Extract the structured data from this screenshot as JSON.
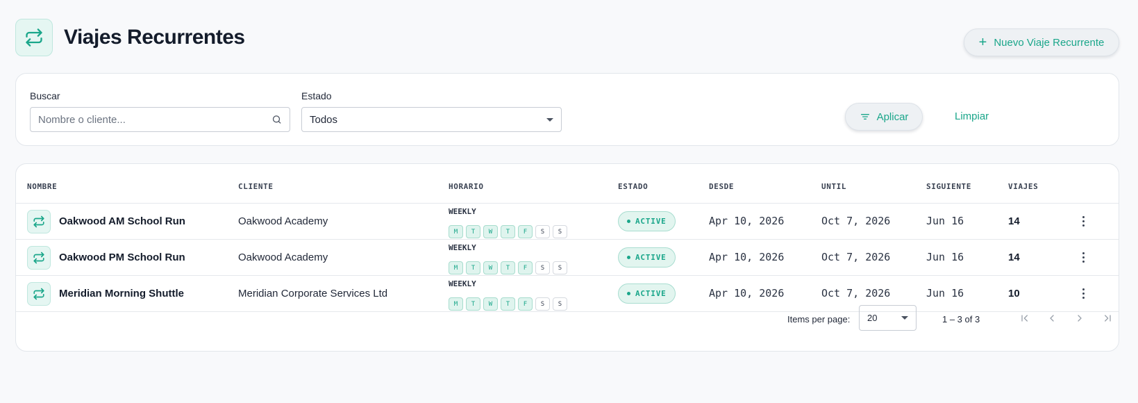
{
  "header": {
    "title": "Viajes Recurrentes",
    "icon": "repeat-icon",
    "new_button_label": "Nuevo Viaje Recurrente"
  },
  "filters": {
    "search_label": "Buscar",
    "search_placeholder": "Nombre o cliente...",
    "status_label": "Estado",
    "status_value": "Todos",
    "apply_label": "Aplicar",
    "clear_label": "Limpiar"
  },
  "table": {
    "columns": [
      "NOMBRE",
      "CLIENTE",
      "HORARIO",
      "ESTADO",
      "DESDE",
      "UNTIL",
      "SIGUIENTE",
      "VIAJES"
    ],
    "rows": [
      {
        "name": "Oakwood AM School Run",
        "client": "Oakwood Academy",
        "schedule": "WEEKLY",
        "days": [
          {
            "label": "M",
            "active": true
          },
          {
            "label": "T",
            "active": true
          },
          {
            "label": "W",
            "active": true
          },
          {
            "label": "T",
            "active": true
          },
          {
            "label": "F",
            "active": true
          },
          {
            "label": "S",
            "active": false
          },
          {
            "label": "S",
            "active": false
          }
        ],
        "status": "ACTIVE",
        "from": "Apr 10, 2026",
        "until": "Oct 7, 2026",
        "next": "Jun 16",
        "trips": "14"
      },
      {
        "name": "Oakwood PM School Run",
        "client": "Oakwood Academy",
        "schedule": "WEEKLY",
        "days": [
          {
            "label": "M",
            "active": true
          },
          {
            "label": "T",
            "active": true
          },
          {
            "label": "W",
            "active": true
          },
          {
            "label": "T",
            "active": true
          },
          {
            "label": "F",
            "active": true
          },
          {
            "label": "S",
            "active": false
          },
          {
            "label": "S",
            "active": false
          }
        ],
        "status": "ACTIVE",
        "from": "Apr 10, 2026",
        "until": "Oct 7, 2026",
        "next": "Jun 16",
        "trips": "14"
      },
      {
        "name": "Meridian Morning Shuttle",
        "client": "Meridian Corporate Services Ltd",
        "schedule": "WEEKLY",
        "days": [
          {
            "label": "M",
            "active": true
          },
          {
            "label": "T",
            "active": true
          },
          {
            "label": "W",
            "active": true
          },
          {
            "label": "T",
            "active": true
          },
          {
            "label": "F",
            "active": true
          },
          {
            "label": "S",
            "active": false
          },
          {
            "label": "S",
            "active": false
          }
        ],
        "status": "ACTIVE",
        "from": "Apr 10, 2026",
        "until": "Oct 7, 2026",
        "next": "Jun 16",
        "trips": "10"
      }
    ]
  },
  "pagination": {
    "items_per_page_label": "Items per page:",
    "items_per_page": "20",
    "range": "1 – 3 of 3"
  },
  "colors": {
    "accent": "#1aa68a",
    "background": "#f8f9fb",
    "text": "#141c2b"
  }
}
